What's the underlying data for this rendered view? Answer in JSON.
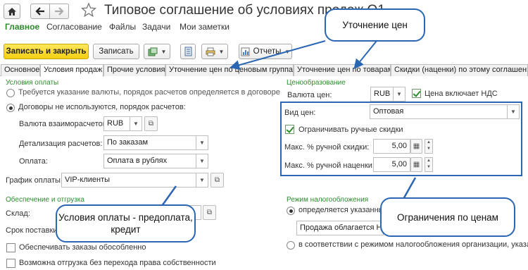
{
  "window": {
    "title": "Типовое соглашение об условиях продаж О1"
  },
  "menu": [
    "Главное",
    "Согласование",
    "Файлы",
    "Задачи",
    "Мои заметки"
  ],
  "toolbar": {
    "save_close": "Записать и закрыть",
    "save": "Записать",
    "reports": "Отчеты"
  },
  "tabs": [
    "Основное",
    "Условия продаж",
    "Прочие условия",
    "Уточнение цен по ценовым группам",
    "Уточнение цен по товарам",
    "Скидки (наценки) по этому соглашению"
  ],
  "payment": {
    "section": "Условия оплаты",
    "radio1": "Требуется указание валюты, порядок расчетов определяется в договоре",
    "radio2": "Договоры не используются, порядок расчетов:",
    "currency_label": "Валюта взаиморасчетов:",
    "currency_value": "RUB",
    "detail_label": "Детализация расчетов:",
    "detail_value": "По заказам",
    "payment_label": "Оплата:",
    "payment_value": "Оплата в рублях",
    "schedule_label": "График оплаты:",
    "schedule_value": "VIP-клиенты"
  },
  "shipping": {
    "section": "Обеспечение и отгрузка",
    "warehouse_label": "Склад:",
    "delivery_label": "Срок поставки",
    "check1": "Обеспечивать заказы обособленно",
    "check2": "Возможна отгрузка без перехода права собственности"
  },
  "pricing": {
    "section": "Ценообразование",
    "currency_label": "Валюта цен:",
    "currency_value": "RUB",
    "vat_label": "Цена включает НДС",
    "price_type_label": "Вид цен:",
    "price_type_value": "Оптовая",
    "limit_label": "Ограничивать ручные скидки",
    "max_discount_label": "Макс. % ручной скидки:",
    "max_discount_value": "5,00",
    "max_markup_label": "Макс. % ручной наценки:",
    "max_markup_value": "5,00"
  },
  "tax": {
    "section": "Режим налогообложения",
    "radio1": "определяется указанны",
    "field_value": "Продажа облагается НД",
    "radio2": "в соответствии с режимом налогообложения организации, указанно"
  },
  "callouts": {
    "price_refine": "Уточнение цен",
    "payment_terms": "Условия оплаты - предоплата, кредит",
    "price_limits": "Ограничения по ценам"
  },
  "colors": {
    "accent_green": "#2e8b2e",
    "callout_blue": "#2b66b3",
    "primary_button": "#f5cf12"
  }
}
